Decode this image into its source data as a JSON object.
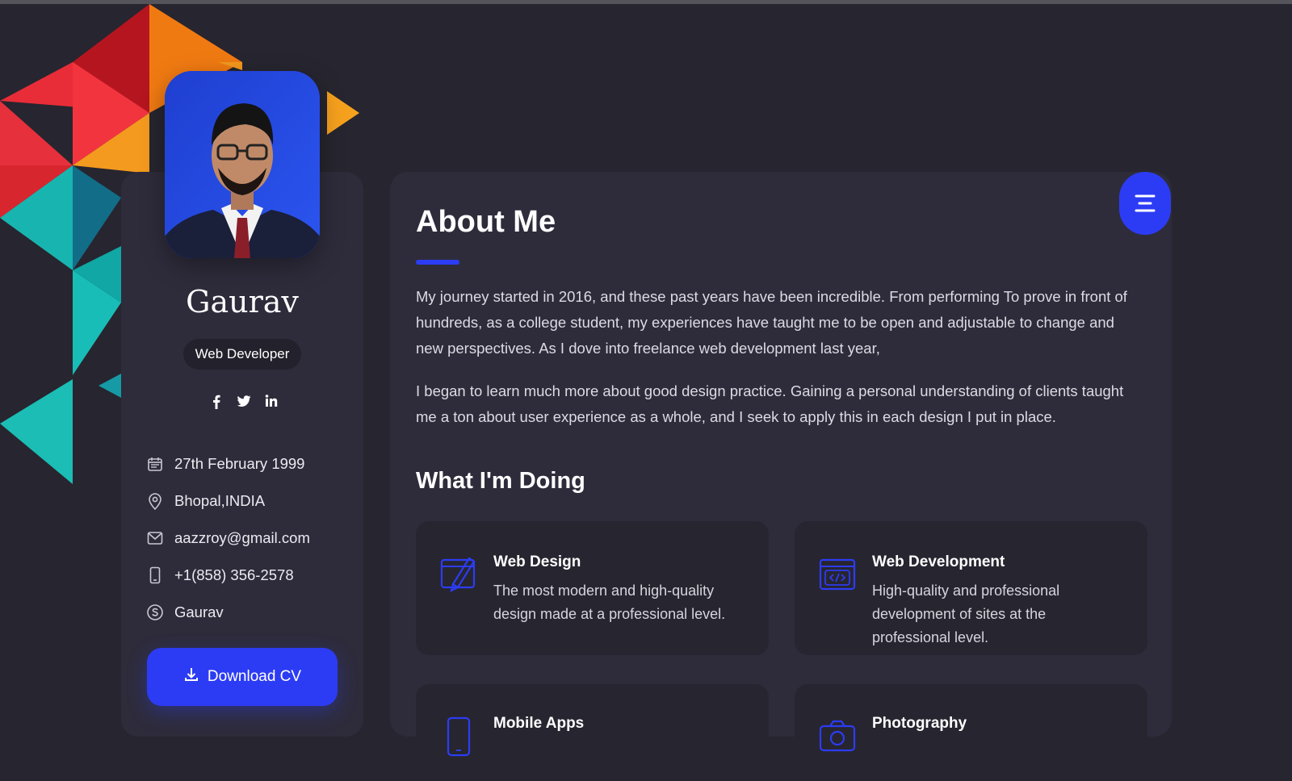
{
  "profile": {
    "name": "Gaurav",
    "role": "Web Developer",
    "social": [
      "facebook-icon",
      "twitter-icon",
      "linkedin-icon"
    ],
    "contacts": [
      {
        "icon": "calendar-icon",
        "text": "27th February 1999"
      },
      {
        "icon": "location-pin-icon",
        "text": "Bhopal,INDIA"
      },
      {
        "icon": "mail-icon",
        "text": "aazzroy@gmail.com"
      },
      {
        "icon": "phone-icon",
        "text": "+1(858) 356-2578"
      },
      {
        "icon": "skype-icon",
        "text": "Gaurav"
      }
    ],
    "download_label": "Download CV"
  },
  "about": {
    "title": "About Me",
    "paragraphs": [
      "My journey started in 2016, and these past years have been incredible. From performing To prove in front of hundreds, as a college student, my experiences have taught me to be open and adjustable to change and new perspectives. As I dove into freelance web development last year,",
      "I began to learn much more about good design practice. Gaining a personal understanding of clients taught me a ton about user experience as a whole, and I seek to apply this in each design I put in place."
    ]
  },
  "doing": {
    "title": "What I'm Doing",
    "services": [
      {
        "icon": "web-design-icon",
        "title": "Web Design",
        "desc": "The most modern and high-quality design made at a professional level."
      },
      {
        "icon": "web-development-icon",
        "title": "Web Development",
        "desc": "High-quality and professional development of sites at the professional level."
      },
      {
        "icon": "mobile-apps-icon",
        "title": "Mobile Apps",
        "desc": ""
      },
      {
        "icon": "photography-icon",
        "title": "Photography",
        "desc": ""
      }
    ]
  },
  "colors": {
    "accent": "#2c3cf4",
    "background": "#27252f",
    "card": "#2e2c3b"
  }
}
